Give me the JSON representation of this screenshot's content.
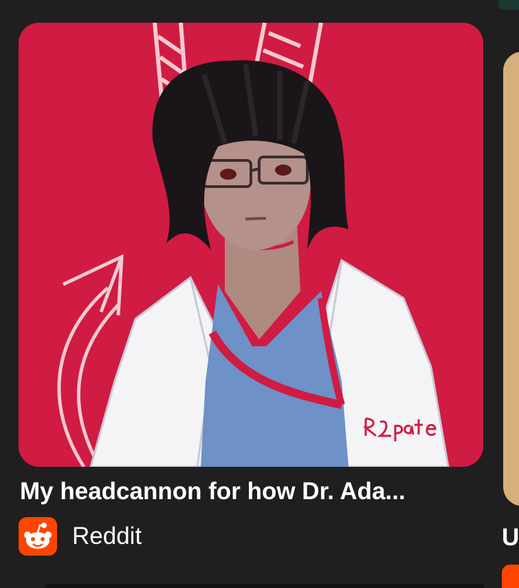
{
  "result_card": {
    "title": "My headcannon for how Dr. Ada...",
    "source_name": "Reddit",
    "source_icon": "reddit-icon",
    "image_signature": "R2patze",
    "accent_color": "#d01b43",
    "source_color": "#ff4500"
  },
  "next_card": {
    "title_fragment": "U",
    "source_icon": "reddit-icon",
    "thumb_color": "#d5b07d"
  }
}
